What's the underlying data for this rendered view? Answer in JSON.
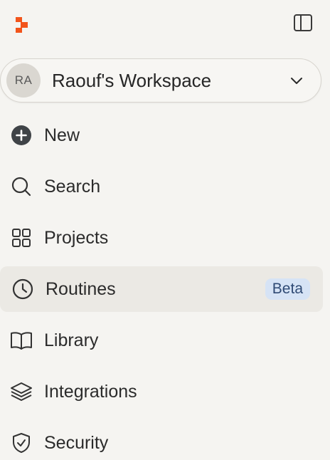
{
  "workspace": {
    "initials": "RA",
    "name": "Raouf's Workspace"
  },
  "nav": {
    "items": [
      {
        "label": "New",
        "icon": "plus-circle-icon"
      },
      {
        "label": "Search",
        "icon": "search-icon"
      },
      {
        "label": "Projects",
        "icon": "grid-icon"
      },
      {
        "label": "Routines",
        "icon": "clock-icon",
        "badge": "Beta",
        "active": true
      },
      {
        "label": "Library",
        "icon": "book-icon"
      },
      {
        "label": "Integrations",
        "icon": "layers-icon"
      },
      {
        "label": "Security",
        "icon": "shield-icon"
      }
    ]
  },
  "colors": {
    "brand": "#f2541b",
    "background": "#f5f4f1",
    "active_row": "#ebe9e4",
    "badge_bg": "#d6e3f5",
    "badge_text": "#2f4a74"
  }
}
